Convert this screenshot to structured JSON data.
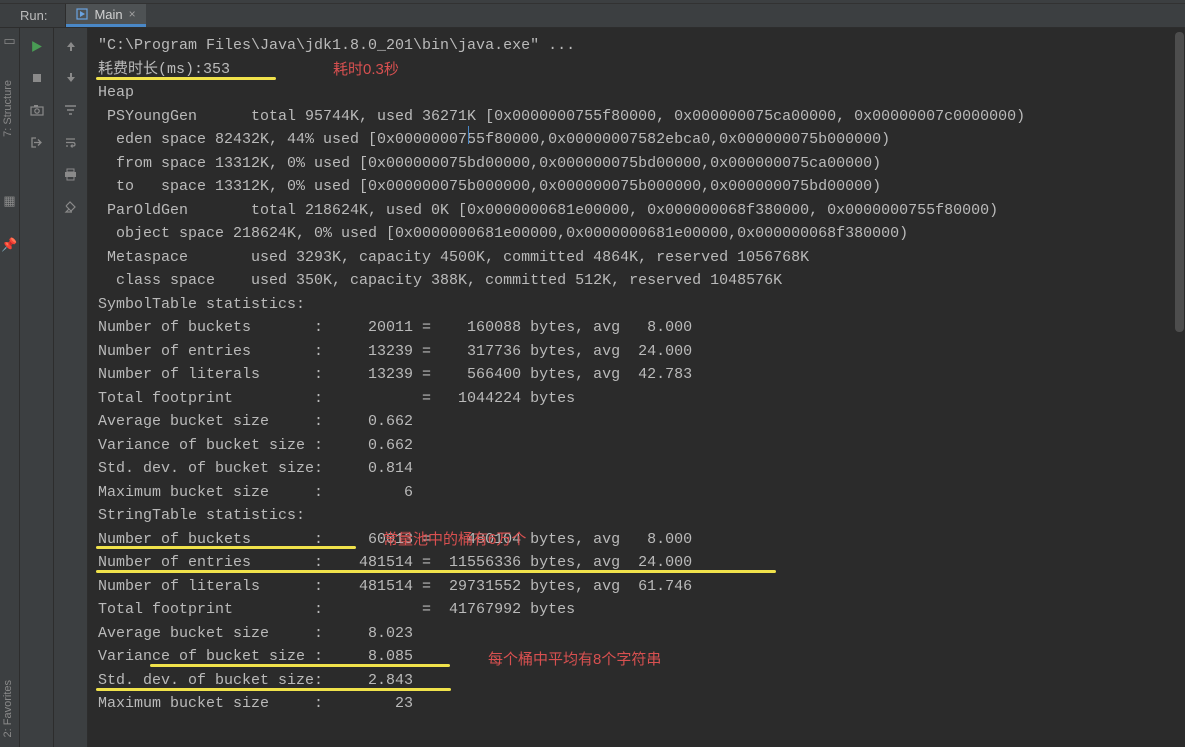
{
  "run_label": "Run:",
  "tab": {
    "title": "Main",
    "close": "×"
  },
  "side_labels": {
    "structure": "7: Structure",
    "favorites": "2: Favorites"
  },
  "annotations": {
    "time": "耗时0.3秒",
    "buckets": "常量池中的桶有6万个",
    "avg": "每个桶中平均有8个字符串"
  },
  "console_lines": [
    "\"C:\\Program Files\\Java\\jdk1.8.0_201\\bin\\java.exe\" ...",
    "耗费时长(ms):353",
    "Heap",
    " PSYoungGen      total 95744K, used 36271K [0x0000000755f80000, 0x000000075ca00000, 0x00000007c0000000)",
    "  eden space 82432K, 44% used [0x0000000755f80000,0x00000007582ebca0,0x000000075b000000)",
    "  from space 13312K, 0% used [0x000000075bd00000,0x000000075bd00000,0x000000075ca00000)",
    "  to   space 13312K, 0% used [0x000000075b000000,0x000000075b000000,0x000000075bd00000)",
    " ParOldGen       total 218624K, used 0K [0x0000000681e00000, 0x000000068f380000, 0x0000000755f80000)",
    "  object space 218624K, 0% used [0x0000000681e00000,0x0000000681e00000,0x000000068f380000)",
    " Metaspace       used 3293K, capacity 4500K, committed 4864K, reserved 1056768K",
    "  class space    used 350K, capacity 388K, committed 512K, reserved 1048576K",
    "SymbolTable statistics:",
    "Number of buckets       :     20011 =    160088 bytes, avg   8.000",
    "Number of entries       :     13239 =    317736 bytes, avg  24.000",
    "Number of literals      :     13239 =    566400 bytes, avg  42.783",
    "Total footprint         :           =   1044224 bytes",
    "Average bucket size     :     0.662",
    "Variance of bucket size :     0.662",
    "Std. dev. of bucket size:     0.814",
    "Maximum bucket size     :         6",
    "StringTable statistics:",
    "Number of buckets       :     60013 =    480104 bytes, avg   8.000",
    "Number of entries       :    481514 =  11556336 bytes, avg  24.000",
    "Number of literals      :    481514 =  29731552 bytes, avg  61.746",
    "Total footprint         :           =  41767992 bytes",
    "Average bucket size     :     8.023",
    "Variance of bucket size :     8.085",
    "Std. dev. of bucket size:     2.843",
    "Maximum bucket size     :        23"
  ]
}
